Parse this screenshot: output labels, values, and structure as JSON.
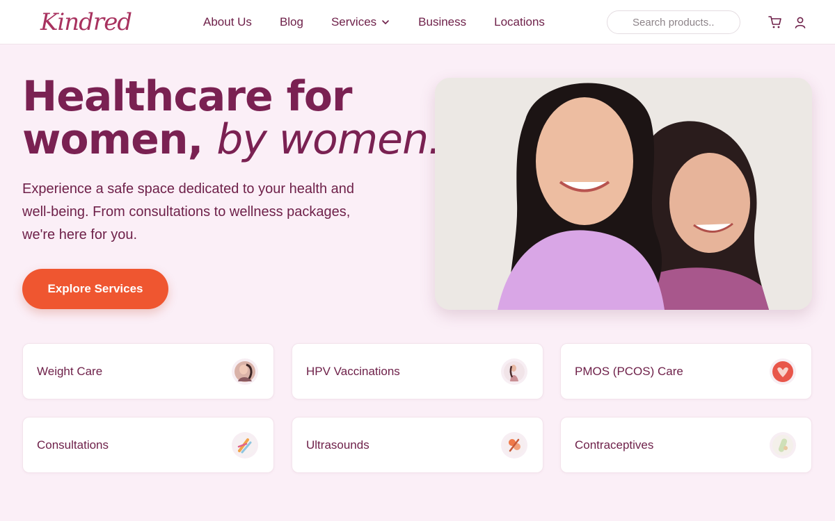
{
  "brand": {
    "logo_text": "Kindred"
  },
  "nav": {
    "items": [
      {
        "label": "About Us"
      },
      {
        "label": "Blog"
      },
      {
        "label": "Services",
        "has_dropdown": true
      },
      {
        "label": "Business"
      },
      {
        "label": "Locations"
      }
    ]
  },
  "search": {
    "placeholder": "Search products.."
  },
  "header_icons": [
    "cart-icon",
    "user-icon"
  ],
  "hero": {
    "title_line1": "Healthcare for",
    "title_line2_main": "women,",
    "title_line2_accent": "by women.",
    "description": "Experience a safe space dedicated to your health and well-being. From consultations to wellness packages, we're here for you.",
    "cta_label": "Explore Services"
  },
  "services": [
    {
      "label": "Weight Care"
    },
    {
      "label": "HPV Vaccinations"
    },
    {
      "label": "PMOS (PCOS) Care"
    },
    {
      "label": "Consultations"
    },
    {
      "label": "Ultrasounds"
    },
    {
      "label": "Contraceptives"
    }
  ],
  "colors": {
    "brand_plum": "#7a2152",
    "cta_orange": "#ef5630",
    "background": "#fbeff7"
  }
}
